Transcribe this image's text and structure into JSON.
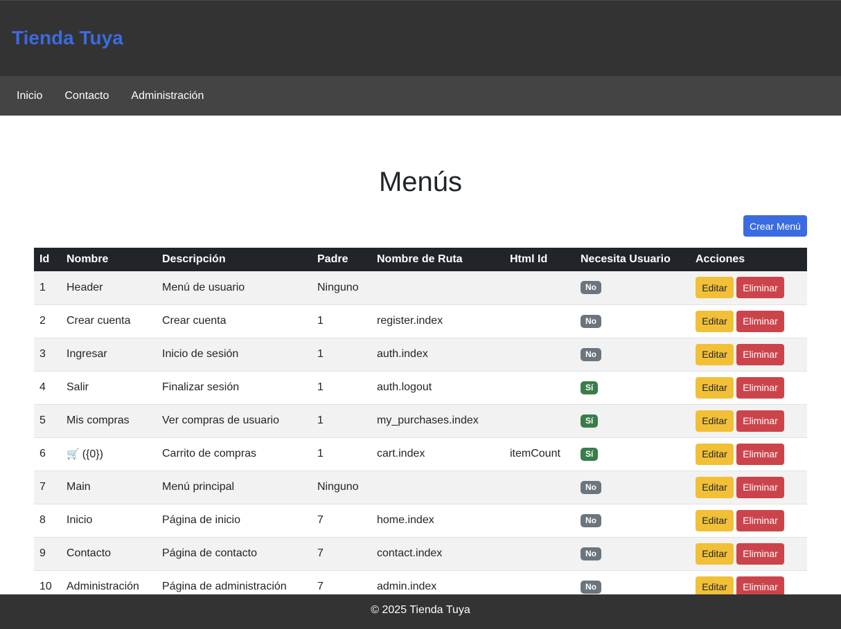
{
  "header": {
    "title": "Tienda Tuya"
  },
  "nav": {
    "items": [
      {
        "label": "Inicio"
      },
      {
        "label": "Contacto"
      },
      {
        "label": "Administración"
      }
    ]
  },
  "page": {
    "title": "Menús",
    "create_button": "Crear Menú"
  },
  "table": {
    "columns": [
      "Id",
      "Nombre",
      "Descripción",
      "Padre",
      "Nombre de Ruta",
      "Html Id",
      "Necesita Usuario",
      "Acciones"
    ],
    "edit_label": "Editar",
    "delete_label": "Eliminar",
    "rows": [
      {
        "id": "1",
        "name": "Header",
        "desc": "Menú de usuario",
        "parent": "Ninguno",
        "route": "",
        "html_id": "",
        "needs_user": "No"
      },
      {
        "id": "2",
        "name": "Crear cuenta",
        "desc": "Crear cuenta",
        "parent": "1",
        "route": "register.index",
        "html_id": "",
        "needs_user": "No"
      },
      {
        "id": "3",
        "name": "Ingresar",
        "desc": "Inicio de sesión",
        "parent": "1",
        "route": "auth.index",
        "html_id": "",
        "needs_user": "No"
      },
      {
        "id": "4",
        "name": "Salir",
        "desc": "Finalizar sesión",
        "parent": "1",
        "route": "auth.logout",
        "html_id": "",
        "needs_user": "Sí"
      },
      {
        "id": "5",
        "name": "Mis compras",
        "desc": "Ver compras de usuario",
        "parent": "1",
        "route": "my_purchases.index",
        "html_id": "",
        "needs_user": "Sí"
      },
      {
        "id": "6",
        "name": "({0})",
        "name_icon": "cart-icon",
        "desc": "Carrito de compras",
        "parent": "1",
        "route": "cart.index",
        "html_id": "itemCount",
        "needs_user": "Sí"
      },
      {
        "id": "7",
        "name": "Main",
        "desc": "Menú principal",
        "parent": "Ninguno",
        "route": "",
        "html_id": "",
        "needs_user": "No"
      },
      {
        "id": "8",
        "name": "Inicio",
        "desc": "Página de inicio",
        "parent": "7",
        "route": "home.index",
        "html_id": "",
        "needs_user": "No"
      },
      {
        "id": "9",
        "name": "Contacto",
        "desc": "Página de contacto",
        "parent": "7",
        "route": "contact.index",
        "html_id": "",
        "needs_user": "No"
      },
      {
        "id": "10",
        "name": "Administración",
        "desc": "Página de administración",
        "parent": "7",
        "route": "admin.index",
        "html_id": "",
        "needs_user": "No"
      }
    ]
  },
  "footer": {
    "text": "© 2025 Tienda Tuya"
  },
  "colors": {
    "brand": "#3b6be0",
    "header_bg": "#333333",
    "nav_bg": "#444444",
    "badge_no": "#6c757d",
    "badge_si": "#3a7d4a",
    "edit": "#f2c037",
    "delete": "#cc444b"
  }
}
